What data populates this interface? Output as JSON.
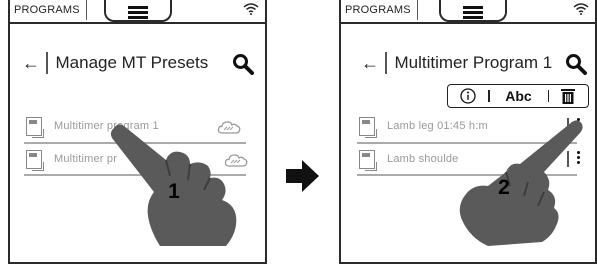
{
  "left_screen": {
    "status_tab": "PROGRAMS",
    "header": {
      "title": "Manage MT Presets"
    },
    "rows": [
      {
        "label": "Multitimer program 1"
      },
      {
        "label": "Multitimer pr"
      }
    ],
    "step": "1"
  },
  "right_screen": {
    "status_tab": "PROGRAMS",
    "header": {
      "title": "Multitimer Program 1"
    },
    "toolbar": {
      "rename_label": "Abc"
    },
    "rows": [
      {
        "label": "Lamb leg 01:45 h:m"
      },
      {
        "label": "Lamb shoulde"
      }
    ],
    "step": "2"
  },
  "icons": {
    "menu": "hamburger-icon",
    "wifi": "wifi-icon",
    "back": "back-arrow-icon",
    "search": "search-icon",
    "file": "program-file-icon",
    "cloud": "cloud-icon",
    "kebab": "kebab-menu-icon",
    "info": "info-icon",
    "delete": "trash-icon",
    "next": "next-step-arrow-icon",
    "hand": "pointing-hand-icon"
  },
  "colors": {
    "frame": "#2a2a2a",
    "hand": "#5a5a5a",
    "arrow": "#111111",
    "muted_text": "#999999"
  }
}
